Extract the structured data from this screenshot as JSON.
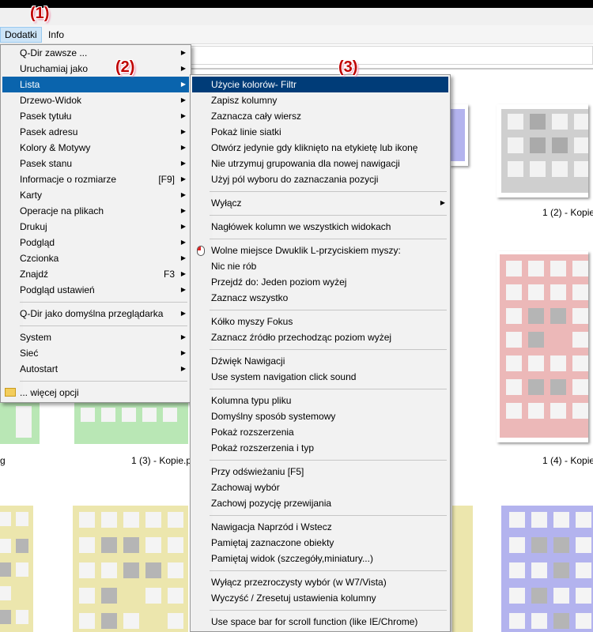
{
  "annotations": [
    "(1)",
    "(2)",
    "(3)"
  ],
  "menubar": {
    "items": [
      "Dodatki",
      "Info"
    ]
  },
  "captions": [
    "1 (2) - Kopie",
    "1 (3) - Kopie.p",
    "1 (4) - Kopie",
    "g"
  ],
  "menu1": {
    "items": [
      {
        "label": "Q-Dir zawsze ...",
        "arrow": true
      },
      {
        "label": "Uruchamiaj jako",
        "arrow": true
      },
      {
        "label": "Lista",
        "arrow": true,
        "highlighted": true
      },
      {
        "label": "Drzewo-Widok",
        "arrow": true
      },
      {
        "label": "Pasek tytułu",
        "arrow": true
      },
      {
        "label": "Pasek adresu",
        "arrow": true
      },
      {
        "label": "Kolory & Motywy",
        "arrow": true
      },
      {
        "label": "Pasek stanu",
        "arrow": true
      },
      {
        "label": "Informacje o rozmiarze",
        "shortcut": "[F9]",
        "arrow": true
      },
      {
        "label": "Karty",
        "arrow": true
      },
      {
        "label": "Operacje na plikach",
        "arrow": true
      },
      {
        "label": "Drukuj",
        "arrow": true
      },
      {
        "label": "Podgląd",
        "arrow": true
      },
      {
        "label": "Czcionka",
        "arrow": true
      },
      {
        "label": "Znajdź",
        "shortcut": "F3",
        "arrow": true
      },
      {
        "label": "Podgląd ustawień",
        "arrow": true
      },
      {
        "label": "Q-Dir jako domyślna przeglądarka",
        "arrow": true
      },
      {
        "label": "System",
        "arrow": true
      },
      {
        "label": "Sieć",
        "arrow": true
      },
      {
        "label": "Autostart",
        "arrow": true
      },
      {
        "label": "... więcej opcji",
        "icon": "folder-icon"
      }
    ]
  },
  "menu2": {
    "items": [
      {
        "label": "Użycie kolorów- Filtr",
        "highlighted": true
      },
      {
        "label": "Zapisz kolumny"
      },
      {
        "label": "Zaznacza cały wiersz"
      },
      {
        "label": "Pokaż linie siatki"
      },
      {
        "label": "Otwórz jedynie gdy kliknięto na etykietę lub ikonę"
      },
      {
        "label": "Nie utrzymuj grupowania dla nowej nawigacji"
      },
      {
        "label": "Użyj pól wyboru do zaznaczania pozycji"
      },
      {
        "label": "Wyłącz",
        "arrow": true
      },
      {
        "label": "Nagłówek kolumn we wszystkich widokach"
      },
      {
        "label": "Wolne miejsce Dwuklik L-przyciskiem myszy:",
        "icon": "mouse-icon"
      },
      {
        "label": "Nic nie rób"
      },
      {
        "label": "Przejdź do: Jeden poziom wyżej"
      },
      {
        "label": "Zaznacz wszystko"
      },
      {
        "label": "Kółko myszy Fokus"
      },
      {
        "label": "Zaznacz źródło przechodząc poziom wyżej"
      },
      {
        "label": "Dźwięk Nawigacji"
      },
      {
        "label": "Use system navigation click sound"
      },
      {
        "label": "Kolumna typu pliku"
      },
      {
        "label": "Domyślny sposób systemowy"
      },
      {
        "label": "Pokaż rozszerzenia"
      },
      {
        "label": "Pokaż rozszerzenia i typ"
      },
      {
        "label": "Przy odświeżaniu [F5]"
      },
      {
        "label": "Zachowaj wybór"
      },
      {
        "label": "Zachowj pozycję przewijania"
      },
      {
        "label": "Nawigacja Naprzód i Wstecz"
      },
      {
        "label": "Pamiętaj zaznaczone obiekty"
      },
      {
        "label": "Pamiętaj widok (szczegóły,miniatury...)"
      },
      {
        "label": "Wyłącz przezroczysty wybór (w W7/Vista)"
      },
      {
        "label": "Wyczyść / Zresetuj ustawienia kolumny"
      },
      {
        "label": "Use space bar for scroll function (like IE/Chrome)"
      }
    ]
  },
  "colors": {
    "highlight": "#0a64ad",
    "annotation": "#c00000",
    "thumb_gray": "#cccccc",
    "thumb_blue": "#b3b3ee",
    "thumb_red": "#ecb8b8",
    "thumb_green": "#b9e7b5",
    "thumb_yellow": "#ece6ad"
  }
}
